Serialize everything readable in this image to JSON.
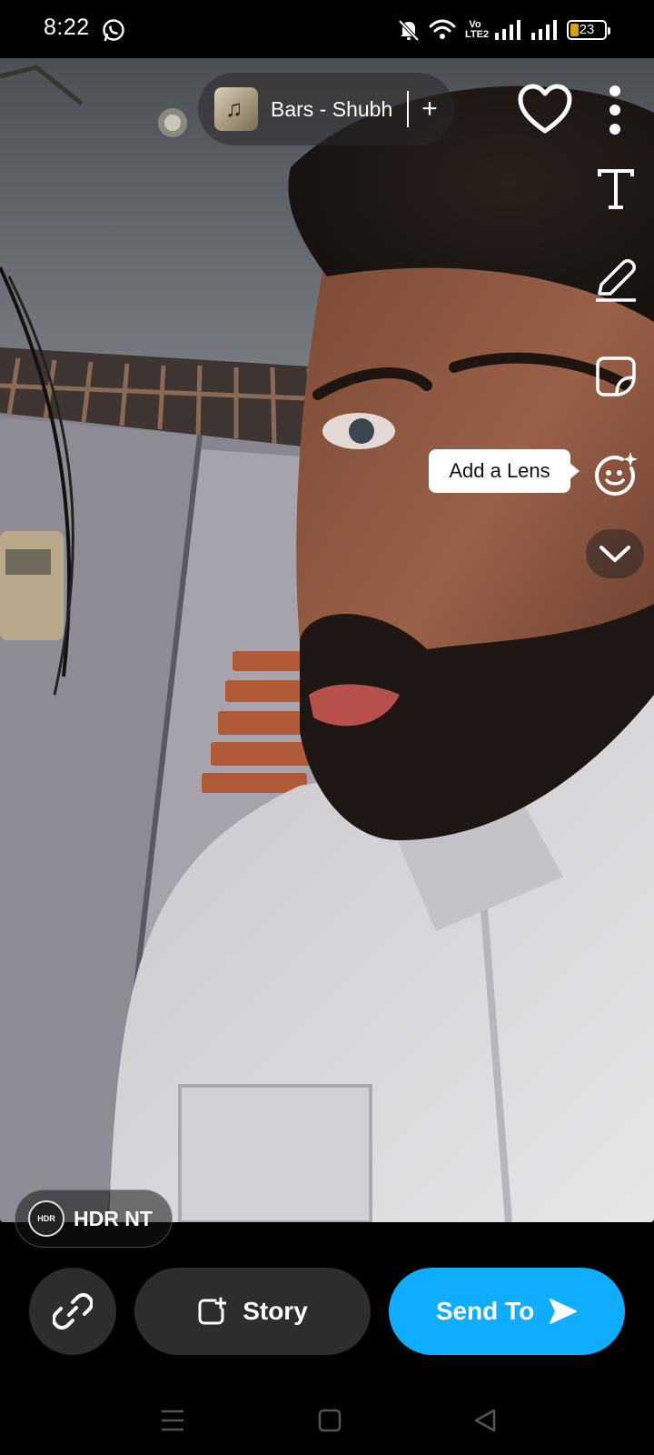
{
  "status_bar": {
    "time": "8:22",
    "battery_level": "23",
    "volte_line1": "Vo",
    "volte_line2": "LTE2"
  },
  "music": {
    "title": "Bars - Shubh",
    "add_symbol": "+"
  },
  "tools": {
    "text_glyph": "T",
    "lens_tooltip": "Add a Lens"
  },
  "filter": {
    "badge": "HDR",
    "label": "HDR NT"
  },
  "actions": {
    "story_label": "Story",
    "send_label": "Send To"
  },
  "colors": {
    "send_accent": "#0fadff",
    "button_dark": "#2d2d2d",
    "battery": "#d4a21a"
  },
  "icons": [
    "whatsapp-icon",
    "mute-icon",
    "wifi-icon",
    "signal-icon",
    "battery-icon",
    "heart-icon",
    "more-icon",
    "text-icon",
    "pencil-icon",
    "sticker-icon",
    "lens-icon",
    "chevron-down-icon",
    "link-icon",
    "story-add-icon",
    "send-arrow-icon",
    "menu-icon",
    "home-icon",
    "back-icon"
  ]
}
